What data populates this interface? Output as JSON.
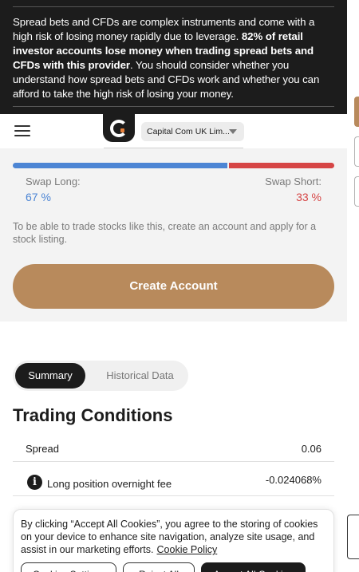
{
  "risk_warning": {
    "text_normal_1": "Spread bets and CFDs are complex instruments and come with a high risk of losing money rapidly due to leverage. ",
    "text_bold": "82% of retail investor accounts lose money when trading spread bets and CFDs with this provider",
    "text_normal_2": ". You should consider whether you understand how spread bets and CFDs work and whether you can afford to take the high risk of losing your money."
  },
  "header": {
    "menu_icon": "hamburger-icon",
    "logo_icon": "capital-com-logo",
    "entity_selector": "Capital Com UK Lim..."
  },
  "swap": {
    "long_label": "Swap Long:",
    "long_value": "67 %",
    "short_label": "Swap Short:",
    "short_value": "33 %",
    "long_fraction": 0.67,
    "long_color": "#4c85d4",
    "short_color": "#d64545"
  },
  "panel": {
    "note": "To be able to trade stocks like this, create an account and apply for a stock listing.",
    "cta_label": "Create Account",
    "cta_color": "#b88a5c"
  },
  "tabs": [
    {
      "label": "Summary",
      "active": true
    },
    {
      "label": "Historical Data",
      "active": false
    }
  ],
  "trading_conditions": {
    "title": "Trading Conditions",
    "rows": [
      {
        "label": "Spread",
        "value": "0.06"
      },
      {
        "label": "Long position overnight fee",
        "value": "-0.024068%",
        "icon": "info-icon"
      }
    ]
  },
  "cookie_banner": {
    "text": "By clicking “Accept All Cookies”, you agree to the storing of cookies on your device to enhance site navigation, analyze site usage, and assist in our marketing efforts.",
    "policy_link": "Cookie Policy",
    "settings_button": "Cookies Settings",
    "reject_button": "Reject All",
    "accept_button": "Accept All Cookies"
  }
}
